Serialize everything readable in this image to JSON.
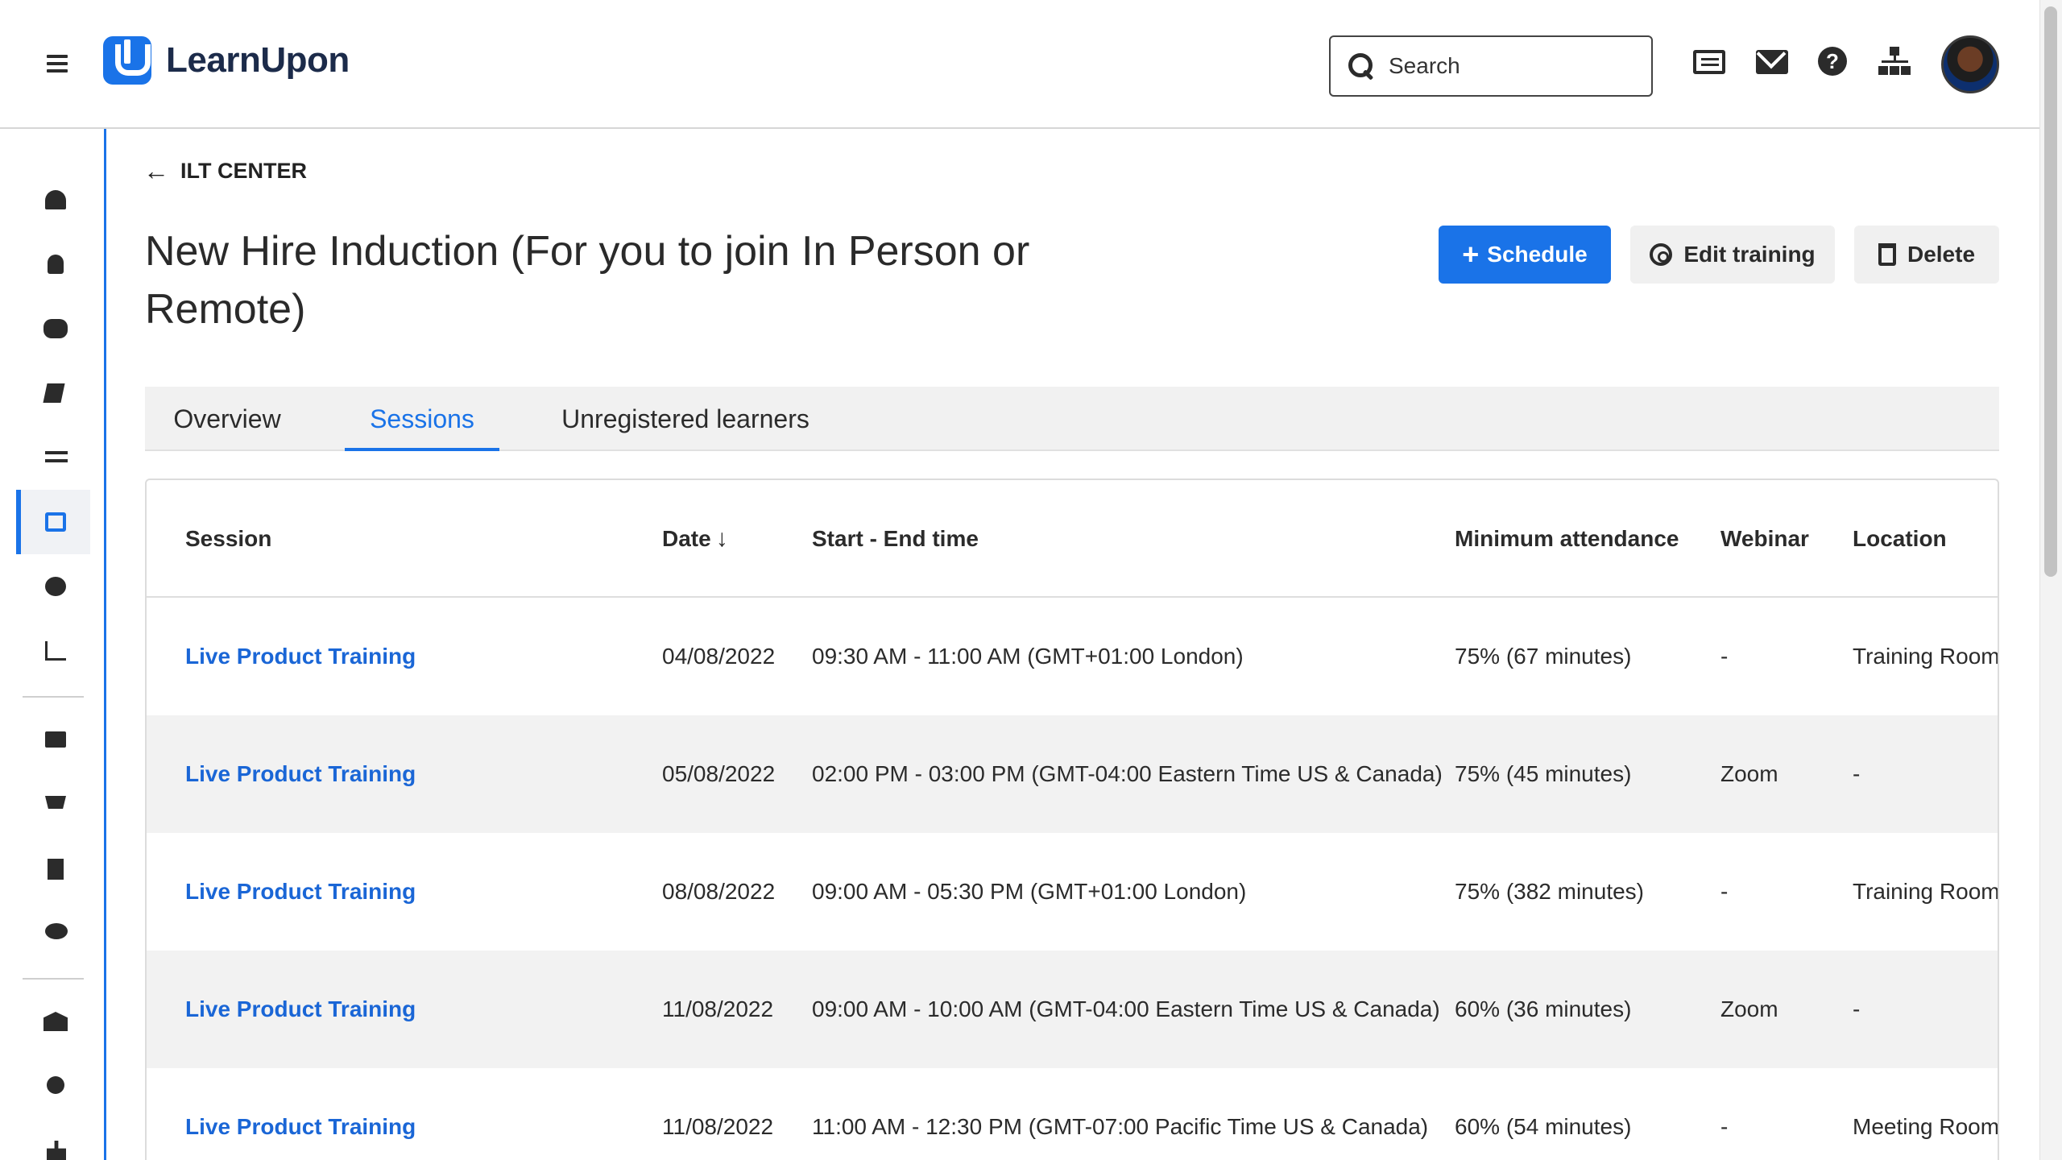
{
  "header": {
    "logo_text": "LearnUpon",
    "search_placeholder": "Search",
    "icons": [
      "menu-icon",
      "messages-icon",
      "mail-icon",
      "help-icon",
      "org-chart-icon",
      "avatar"
    ]
  },
  "sidebar": {
    "items": [
      {
        "icon": "dashboard-icon"
      },
      {
        "icon": "user-icon"
      },
      {
        "icon": "groups-icon"
      },
      {
        "icon": "courses-icon"
      },
      {
        "icon": "exchange-icon"
      },
      {
        "icon": "calendar-icon",
        "active": true
      },
      {
        "icon": "pie-chart-icon"
      },
      {
        "icon": "bar-chart-icon"
      },
      {
        "icon": "folder-icon"
      },
      {
        "icon": "cart-icon"
      },
      {
        "icon": "document-icon"
      },
      {
        "icon": "chat-icon"
      },
      {
        "icon": "institution-icon"
      },
      {
        "icon": "badge-icon"
      },
      {
        "icon": "hierarchy-icon"
      }
    ]
  },
  "breadcrumb": {
    "back_label": "ILT CENTER"
  },
  "page": {
    "title": "New Hire Induction (For you to join In Person or Remote)"
  },
  "actions": {
    "schedule_label": "Schedule",
    "edit_label": "Edit training",
    "delete_label": "Delete"
  },
  "tabs": [
    {
      "label": "Overview"
    },
    {
      "label": "Sessions",
      "active": true
    },
    {
      "label": "Unregistered learners"
    }
  ],
  "table": {
    "columns": {
      "session": "Session",
      "date": "Date",
      "time": "Start - End time",
      "min_attendance": "Minimum attendance",
      "webinar": "Webinar",
      "location": "Location"
    },
    "rows": [
      {
        "session": "Live Product Training",
        "date": "04/08/2022",
        "time": "09:30 AM - 11:00 AM (GMT+01:00 London)",
        "min_attendance": "75% (67 minutes)",
        "webinar": "-",
        "location": "Training Room"
      },
      {
        "session": "Live Product Training",
        "date": "05/08/2022",
        "time": "02:00 PM - 03:00 PM (GMT-04:00 Eastern Time US & Canada)",
        "min_attendance": "75% (45 minutes)",
        "webinar": "Zoom",
        "location": "-"
      },
      {
        "session": "Live Product Training",
        "date": "08/08/2022",
        "time": "09:00 AM - 05:30 PM (GMT+01:00 London)",
        "min_attendance": "75% (382 minutes)",
        "webinar": "-",
        "location": "Training Room"
      },
      {
        "session": "Live Product Training",
        "date": "11/08/2022",
        "time": "09:00 AM - 10:00 AM (GMT-04:00 Eastern Time US & Canada)",
        "min_attendance": "60% (36 minutes)",
        "webinar": "Zoom",
        "location": "-"
      },
      {
        "session": "Live Product Training",
        "date": "11/08/2022",
        "time": "11:00 AM - 12:30 PM (GMT-07:00 Pacific Time US & Canada)",
        "min_attendance": "60% (54 minutes)",
        "webinar": "-",
        "location": "Meeting Room"
      }
    ]
  },
  "colors": {
    "accent": "#1a73e8",
    "link": "#1a66d6",
    "row_alt": "#f2f2f2"
  }
}
